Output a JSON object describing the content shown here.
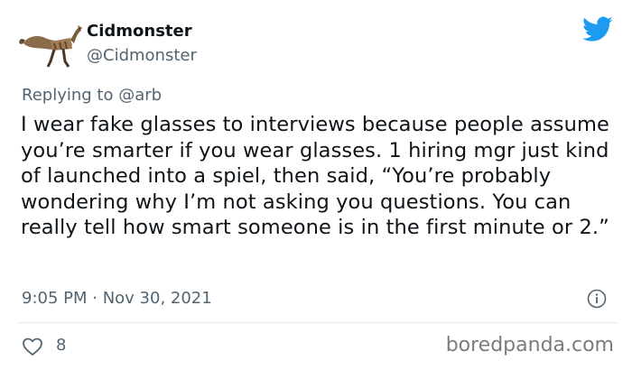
{
  "author": {
    "display_name": "Cidmonster",
    "handle": "@Cidmonster"
  },
  "reply": {
    "prefix": "Replying to",
    "mention": "@arb"
  },
  "tweet": {
    "text": "I wear fake glasses to interviews because people assume you’re smarter if you wear glasses. 1 hiring mgr just kind of launched into a spiel, then said, “You’re probably wondering why I’m not asking you questions. You can really tell how smart someone is in the first minute or 2.”",
    "timestamp": "9:05 PM · Nov 30, 2021"
  },
  "stats": {
    "likes": "8"
  },
  "watermark": "boredpanda.com",
  "icons": [
    "avatar",
    "twitter-bird-icon",
    "info-icon",
    "heart-icon"
  ],
  "colors": {
    "twitter_blue": "#1d9bf0",
    "secondary_text": "#536471",
    "primary_text": "#0f1419"
  }
}
